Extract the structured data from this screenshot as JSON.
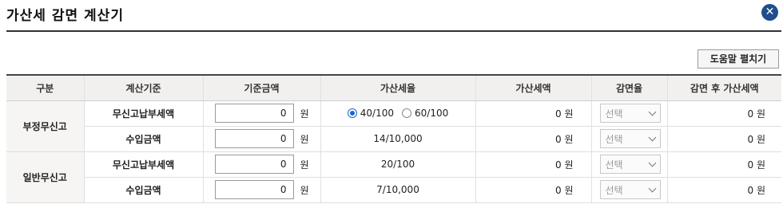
{
  "dialog": {
    "title": "가산세 감면 계산기",
    "close_icon": "close-icon",
    "help_button": "도움말 펼치기"
  },
  "table": {
    "headers": [
      "구분",
      "계산기준",
      "기준금액",
      "가산세율",
      "가산세액",
      "감면율",
      "감면 후 가산세액"
    ],
    "groups": [
      {
        "label": "부정무신고",
        "rows": [
          {
            "basis": "무신고납부세액",
            "amount": "0",
            "unit": "원",
            "rate_options": [
              "40/100",
              "60/100"
            ],
            "rate_selected": "40/100",
            "tax": "0 원",
            "reduction": "선택",
            "after": "0 원"
          },
          {
            "basis": "수입금액",
            "amount": "0",
            "unit": "원",
            "rate": "14/10,000",
            "tax": "0 원",
            "reduction": "선택",
            "after": "0 원"
          }
        ]
      },
      {
        "label": "일반무신고",
        "rows": [
          {
            "basis": "무신고납부세액",
            "amount": "0",
            "unit": "원",
            "rate": "20/100",
            "tax": "0 원",
            "reduction": "선택",
            "after": "0 원"
          },
          {
            "basis": "수입금액",
            "amount": "0",
            "unit": "원",
            "rate": "7/10,000",
            "tax": "0 원",
            "reduction": "선택",
            "after": "0 원"
          }
        ]
      }
    ]
  }
}
